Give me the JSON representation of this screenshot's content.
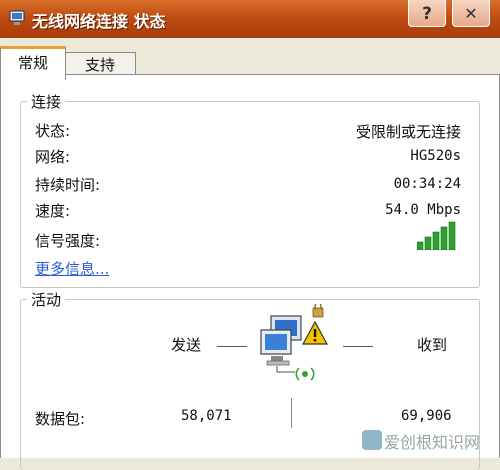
{
  "window": {
    "title": "无线网络连接 状态",
    "help_glyph": "?",
    "close_glyph": "✕"
  },
  "tabs": [
    {
      "label": "常规",
      "active": true
    },
    {
      "label": "支持",
      "active": false
    }
  ],
  "connection": {
    "legend": "连接",
    "rows": [
      {
        "label": "状态:",
        "value": "受限制或无连接"
      },
      {
        "label": "网络:",
        "value": "HG520s"
      },
      {
        "label": "持续时间:",
        "value": "00:34:24"
      },
      {
        "label": "速度:",
        "value": "54.0 Mbps"
      },
      {
        "label": "信号强度:",
        "value": ""
      }
    ],
    "signal_level": 5,
    "signal_color": "#2ea02e",
    "more_link": "更多信息..."
  },
  "activity": {
    "legend": "活动",
    "sent_label": "发送",
    "received_label": "收到",
    "packets_label": "数据包:",
    "sent_value": "58,071",
    "received_value": "69,906",
    "status_icon": "network-warning-icon"
  },
  "watermark": {
    "text": "爱创根知识网"
  },
  "colors": {
    "titlebar": "#c04c12",
    "link": "#2a5bd7"
  }
}
